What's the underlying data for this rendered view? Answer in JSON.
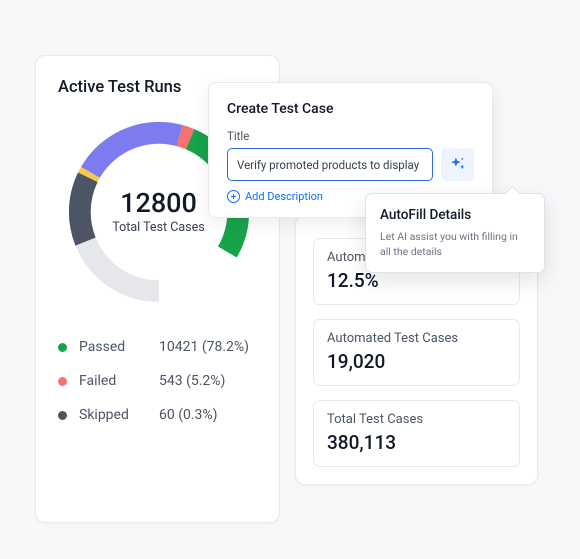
{
  "colors": {
    "passed": "#17a34a",
    "failed": "#f87171",
    "skipped": "#4b5563",
    "purple": "#7c7cf0",
    "gold": "#f7c948",
    "remain": "#e5e7eb",
    "accent": "#2d6cdf"
  },
  "runs": {
    "title": "Active Test Runs",
    "center_number": "12800",
    "center_label": "Total Test Cases",
    "legend": [
      {
        "label": "Passed",
        "value": "10421 (78.2%)",
        "color_key": "passed"
      },
      {
        "label": "Failed",
        "value": "543 (5.2%)",
        "color_key": "failed"
      },
      {
        "label": "Skipped",
        "value": "60 (0.3%)",
        "color_key": "skipped"
      }
    ]
  },
  "chart_data": {
    "type": "pie",
    "title": "Active Test Runs",
    "total": 12800,
    "series": [
      {
        "name": "Passed",
        "value": 10421,
        "pct": 78.2,
        "color": "#17a34a"
      },
      {
        "name": "Failed",
        "value": 543,
        "pct": 5.2,
        "color": "#f87171"
      },
      {
        "name": "Skipped",
        "value": 60,
        "pct": 0.3,
        "color": "#4b5563"
      }
    ],
    "donut_arc_extent_deg": 300,
    "visual_segments": [
      {
        "name": "green",
        "span_deg": 97,
        "color": "#17a34a"
      },
      {
        "name": "red",
        "span_deg": 8,
        "color": "#f87171"
      },
      {
        "name": "purple",
        "span_deg": 75,
        "color": "#7c7cf0"
      },
      {
        "name": "gold",
        "span_deg": 4,
        "color": "#f7c948"
      },
      {
        "name": "slate",
        "span_deg": 48,
        "color": "#4b5563"
      },
      {
        "name": "remain",
        "span_deg": 68,
        "color": "#e5e7eb"
      }
    ]
  },
  "stats": {
    "items": [
      {
        "label": "Automation Coverage",
        "value": "12.5%"
      },
      {
        "label": "Automated Test Cases",
        "value": "19,020"
      },
      {
        "label": "Total Test Cases",
        "value": "380,113"
      }
    ]
  },
  "create": {
    "heading": "Create Test Case",
    "field_label": "Title",
    "title_value": "Verify promoted products to display",
    "add_description": "Add Description"
  },
  "tooltip": {
    "title": "AutoFill Details",
    "body": "Let AI assist you with filling in all the details"
  }
}
